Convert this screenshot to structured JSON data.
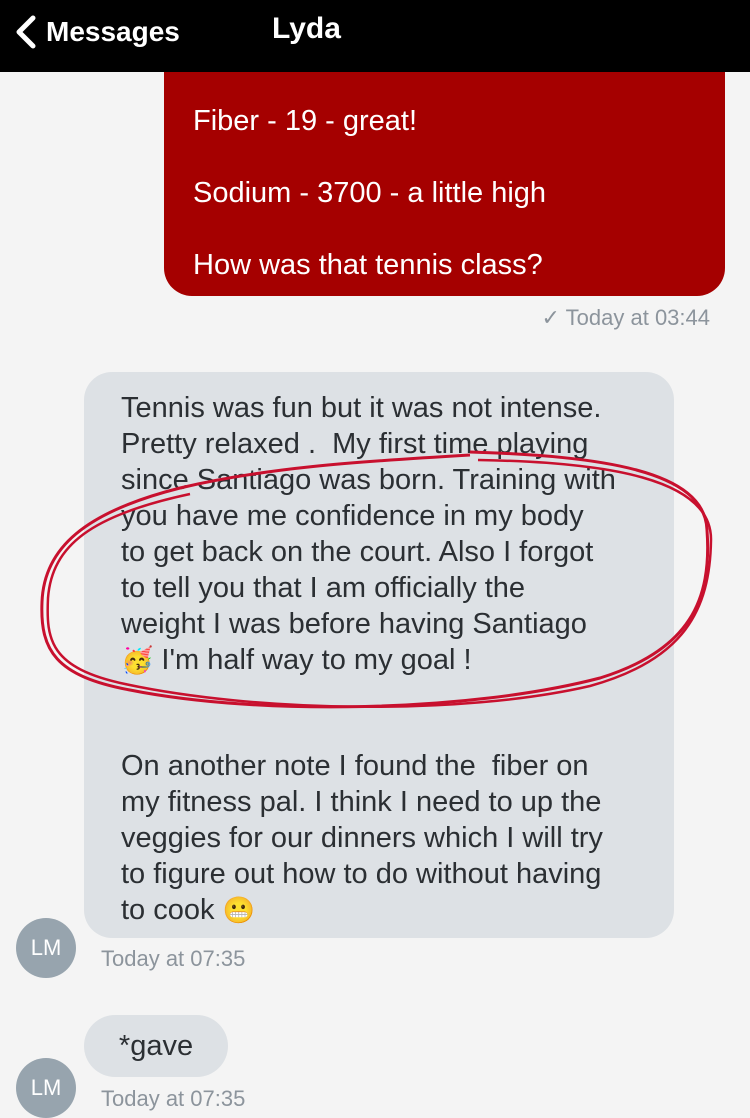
{
  "header": {
    "back_label": "Messages",
    "contact_name": "Lyda"
  },
  "outgoing": {
    "lines": [
      "Fiber - 19 - great!",
      "Sodium - 3700 - a little high",
      "How was that tennis class?"
    ],
    "status": "✓ Today at 03:44",
    "color": "#a50000"
  },
  "incoming": {
    "paragraph1": "Tennis was fun but it was not intense.\nPretty relaxed .  My first time playing\nsince Santiago was born. Training with\nyou have me confidence in my body\nto get back on the court. Also I forgot\nto tell you that I am officially the\nweight I was before having Santiago",
    "paragraph1_emoji": "🥳",
    "paragraph1_end": " I'm half way to my goal !",
    "paragraph2": "On another note I found the  fiber on\nmy fitness pal. I think I need to up the\nveggies for our dinners which I will try\nto figure out how to do without having\nto cook ",
    "paragraph2_emoji": "😬",
    "sender_initials": "LM",
    "status": "Today at 07:35"
  },
  "incoming2": {
    "text": "*gave",
    "sender_initials": "LM",
    "status": "Today at 07:35"
  },
  "annotation": {
    "color": "#c8102e"
  }
}
